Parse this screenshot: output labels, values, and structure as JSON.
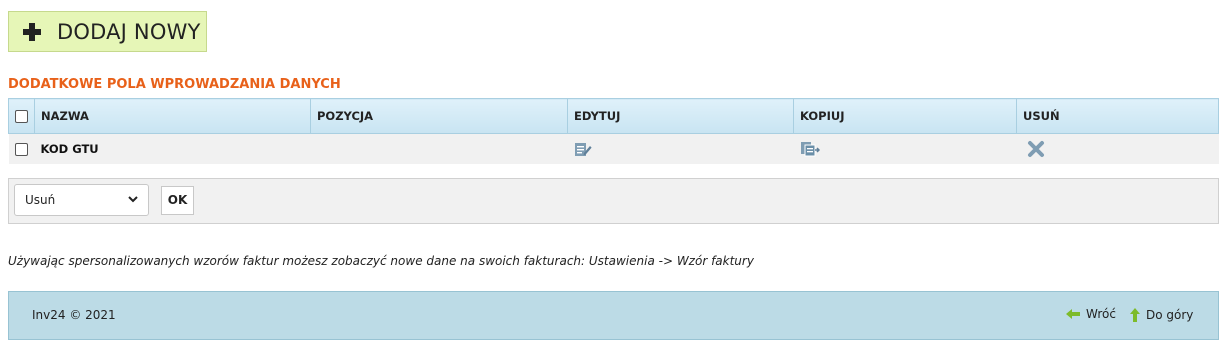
{
  "toolbar": {
    "add_new_label": "DODAJ NOWY"
  },
  "section": {
    "title": "DODATKOWE POLA WPROWADZANIA DANYCH"
  },
  "table": {
    "columns": [
      "NAZWA",
      "POZYCJA",
      "EDYTUJ",
      "KOPIUJ",
      "USUŃ"
    ],
    "rows": [
      {
        "name": "KOD GTU",
        "position": ""
      }
    ]
  },
  "bulk_action": {
    "selected": "Usuń",
    "ok_label": "OK"
  },
  "note": "Używając spersonalizowanych wzorów faktur możesz zobaczyć nowe dane na swoich fakturach: Ustawienia -> Wzór faktury",
  "footer": {
    "copyright": "Inv24 © 2021",
    "back_label": "Wróć",
    "top_label": "Do góry"
  },
  "colors": {
    "accent": "#e8611a",
    "add_button_bg": "#e6f6b7",
    "header_bg": "#c8e4f2",
    "footer_bg": "#bcdbe6",
    "icon_blue": "#6b8fa8",
    "arrow_green": "#7dbb2a"
  }
}
